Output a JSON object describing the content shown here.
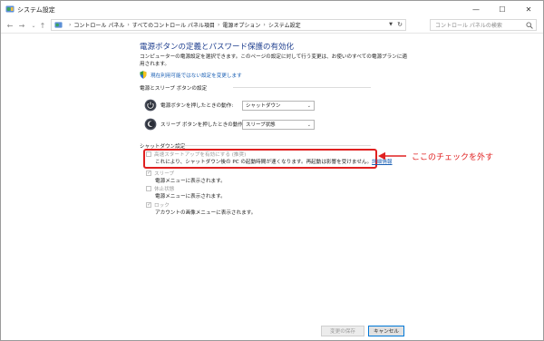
{
  "window": {
    "title": "システム設定"
  },
  "controls": {
    "minimize": "—",
    "maximize": "☐",
    "close": "✕"
  },
  "nav": {
    "back": "←",
    "forward": "→",
    "recent": "⌄",
    "up": "↑"
  },
  "breadcrumb": {
    "items": [
      "コントロール パネル",
      "すべてのコントロール パネル項目",
      "電源オプション",
      "システム設定"
    ],
    "separator": "›"
  },
  "search": {
    "placeholder": "コントロール パネルの検索"
  },
  "page": {
    "title": "電源ボタンの定義とパスワード保護の有効化",
    "description": "コンピューターの電源設定を選択できます。このページの設定に対して行う変更は、お使いのすべての電源プランに適用されます。",
    "link": "現在利用可能ではない設定を変更します"
  },
  "power_settings": {
    "title": "電源とスリープ ボタンの設定",
    "rows": [
      {
        "label": "電源ボタンを押したときの動作:",
        "value": "シャットダウン"
      },
      {
        "label": "スリープ ボタンを押したときの動作:",
        "value": "スリープ状態"
      }
    ]
  },
  "shutdown_settings": {
    "title": "シャットダウン設定",
    "options": [
      {
        "label": "高速スタートアップを有効にする (推奨)",
        "checked": false,
        "description": "これにより、シャットダウン後の PC の起動時間が速くなります。再起動は影響を受けません。",
        "link": "詳細情報"
      },
      {
        "label": "スリープ",
        "checked": true,
        "description": "電源メニューに表示されます。"
      },
      {
        "label": "休止状態",
        "checked": false,
        "description": "電源メニューに表示されます。"
      },
      {
        "label": "ロック",
        "checked": true,
        "description": "アカウントの画像メニューに表示されます。"
      }
    ]
  },
  "annotation": {
    "text": "ここのチェックを外す",
    "color": "#e02020"
  },
  "buttons": {
    "save": "変更の保存",
    "cancel": "キャンセル"
  },
  "colors": {
    "title_blue": "#1f3f8f",
    "link_blue": "#1a5fb4",
    "highlight_red": "#e02020"
  }
}
